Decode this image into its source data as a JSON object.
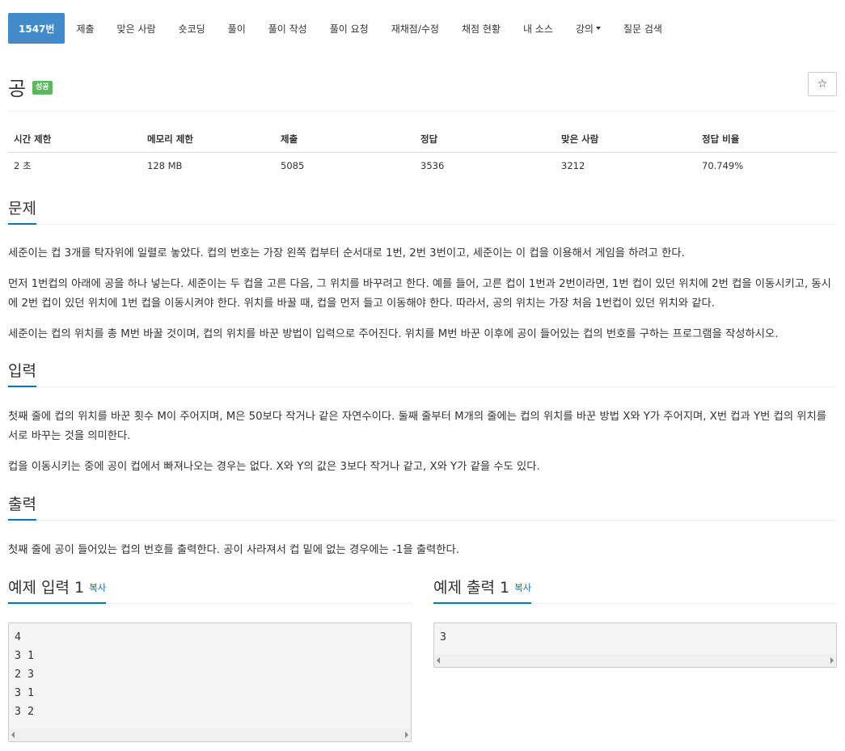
{
  "nav": {
    "items": [
      "1547번",
      "제출",
      "맞은 사람",
      "숏코딩",
      "풀이",
      "풀이 작성",
      "풀이 요청",
      "재채점/수정",
      "채점 현황",
      "내 소스",
      "강의",
      "질문 검색"
    ]
  },
  "problem": {
    "title": "공",
    "badge": "성공",
    "star": "☆"
  },
  "info": {
    "headers": [
      "시간 제한",
      "메모리 제한",
      "제출",
      "정답",
      "맞은 사람",
      "정답 비율"
    ],
    "values": [
      "2 초",
      "128 MB",
      "5085",
      "3536",
      "3212",
      "70.749%"
    ]
  },
  "sections": {
    "description": {
      "heading": "문제",
      "paragraphs": [
        "세준이는 컵 3개를 탁자위에 일렬로 놓았다. 컵의 번호는 가장 왼쪽 컵부터 순서대로 1번, 2번 3번이고, 세준이는 이 컵을 이용해서 게임을 하려고 한다.",
        "먼저 1번컵의 아래에 공을 하나 넣는다. 세준이는 두 컵을 고른 다음, 그 위치를 바꾸려고 한다. 예를 들어, 고른 컵이 1번과 2번이라면, 1번 컵이 있던 위치에 2번 컵을 이동시키고, 동시에 2번 컵이 있던 위치에 1번 컵을 이동시켜야 한다. 위치를 바꿀 때, 컵을 먼저 들고 이동해야 한다. 따라서, 공의 위치는 가장 처음 1번컵이 있던 위치와 같다.",
        "세준이는 컵의 위치를 총 M번 바꿀 것이며, 컵의 위치를 바꾼 방법이 입력으로 주어진다. 위치를 M번 바꾼 이후에 공이 들어있는 컵의 번호를 구하는 프로그램을 작성하시오."
      ]
    },
    "input": {
      "heading": "입력",
      "paragraphs": [
        "첫째 줄에 컵의 위치를 바꾼 횟수 M이 주어지며, M은 50보다 작거나 같은 자연수이다. 둘째 줄부터 M개의 줄에는 컵의 위치를 바꾼 방법 X와 Y가 주어지며, X번 컵과 Y번 컵의 위치를 서로 바꾸는 것을 의미한다.",
        "컵을 이동시키는 중에 공이 컵에서 빠져나오는 경우는 없다. X와 Y의 값은 3보다 작거나 같고, X와 Y가 같을 수도 있다."
      ]
    },
    "output": {
      "heading": "출력",
      "paragraphs": [
        "첫째 줄에 공이 들어있는 컵의 번호를 출력한다. 공이 사라져서 컵 밑에 없는 경우에는 -1을 출력한다."
      ]
    }
  },
  "examples": {
    "input": {
      "heading": "예제 입력 1",
      "copy": "복사",
      "lines": [
        "4",
        "3 1",
        "2 3",
        "3 1",
        "3 2"
      ]
    },
    "output": {
      "heading": "예제 출력 1",
      "copy": "복사",
      "lines": [
        "3"
      ]
    }
  }
}
